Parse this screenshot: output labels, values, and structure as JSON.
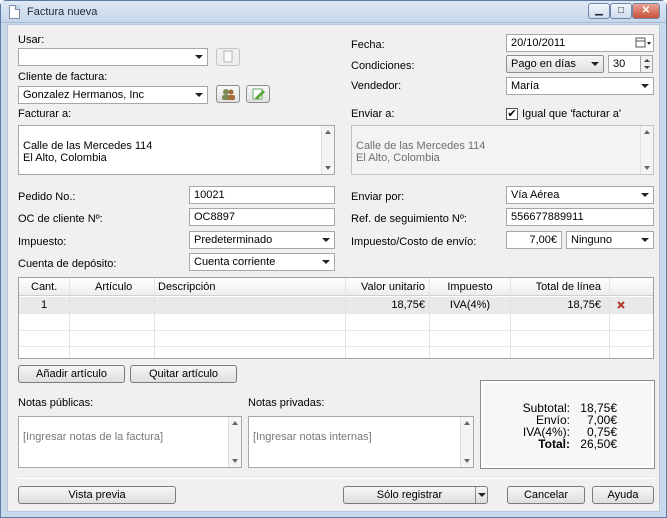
{
  "window": {
    "title": "Factura nueva",
    "minimize": "▁",
    "maximize": "□",
    "close": "✕"
  },
  "left": {
    "usar_label": "Usar:",
    "usar_value": "",
    "cliente_label": "Cliente de factura:",
    "cliente_value": "Gonzalez Hermanos, Inc",
    "facturar_label": "Facturar a:",
    "facturar_value": "Calle de las Mercedes 114\nEl Alto, Colombia"
  },
  "right": {
    "fecha_label": "Fecha:",
    "fecha_value": "20/10/2011",
    "condiciones_label": "Condiciones:",
    "condiciones_value": "Pago en días",
    "condiciones_days": "30",
    "vendedor_label": "Vendedor:",
    "vendedor_value": "María",
    "enviar_label": "Enviar a:",
    "igual_label": "Igual que 'facturar a'",
    "igual_checked": "✔",
    "enviar_value": "Calle de las Mercedes 114\nEl Alto, Colombia"
  },
  "mid": {
    "pedido_label": "Pedido No.:",
    "pedido_value": "10021",
    "oc_label": "OC de cliente Nº:",
    "oc_value": "OC8897",
    "impuesto_label": "Impuesto:",
    "impuesto_value": "Predeterminado",
    "cuenta_label": "Cuenta de depósito:",
    "cuenta_value": "Cuenta corriente",
    "enviarpor_label": "Enviar por:",
    "enviarpor_value": "Vía Aérea",
    "ref_label": "Ref. de seguimiento Nº:",
    "ref_value": "556677889911",
    "costo_label": "Impuesto/Costo de envío:",
    "costo_value": "7,00€",
    "costo_tax": "Ninguno"
  },
  "grid": {
    "headers": [
      "Cant.",
      "Artículo",
      "Descripción",
      "Valor unitario",
      "Impuesto",
      "Total de línea"
    ],
    "rows": [
      {
        "cant": "1",
        "articulo": "",
        "descripcion": "",
        "valor": "18,75€",
        "impuesto": "IVA(4%)",
        "total": "18,75€"
      }
    ]
  },
  "buttons": {
    "add_item": "Añadir artículo",
    "remove_item": "Quitar artículo",
    "preview": "Vista previa",
    "save": "Sólo registrar",
    "cancel": "Cancelar",
    "help": "Ayuda"
  },
  "notes": {
    "public_label": "Notas públicas:",
    "public_placeholder": "[Ingresar notas de la factura]",
    "private_label": "Notas privadas:",
    "private_placeholder": "[Ingresar notas internas]"
  },
  "totals": {
    "subtotal_label": "Subtotal:",
    "subtotal_value": "18,75€",
    "envio_label": "Envío:",
    "envio_value": "7,00€",
    "iva_label": "IVA(4%):",
    "iva_value": "0,75€",
    "total_label": "Total:",
    "total_value": "26,50€"
  }
}
